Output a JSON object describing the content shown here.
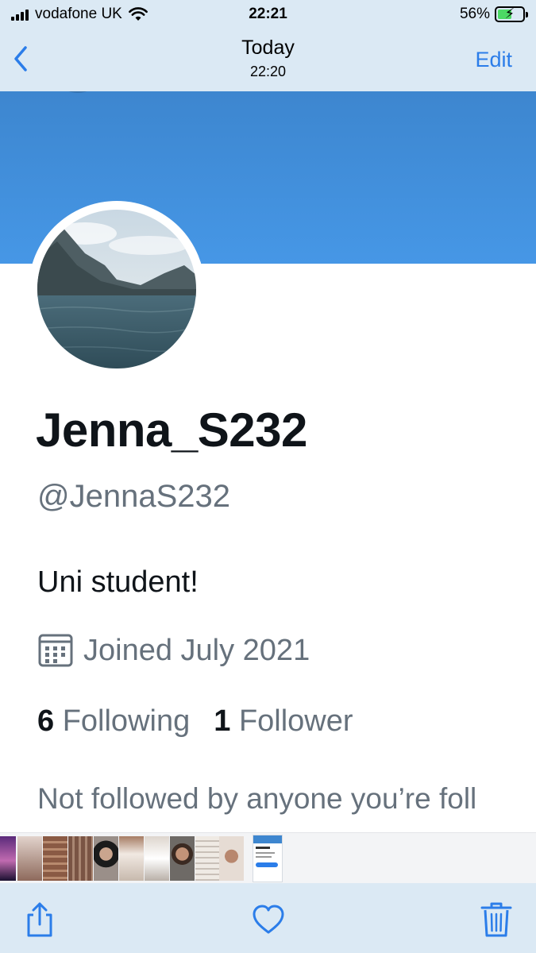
{
  "status_bar": {
    "carrier": "vodafone UK",
    "time": "22:21",
    "battery_percent": "56%",
    "battery_level": 0.56,
    "signal_icon": "cellular-signal-icon",
    "wifi_icon": "wifi-icon",
    "battery_icon": "battery-charging-icon"
  },
  "nav": {
    "title": "Today",
    "subtitle": "22:20",
    "edit_label": "Edit",
    "back_icon": "chevron-left-icon"
  },
  "profile": {
    "display_name": "Jenna_S232",
    "handle": "@JennaS232",
    "bio": "Uni student!",
    "joined": "Joined July 2021",
    "following_count": "6",
    "following_label": "Following",
    "followers_count": "1",
    "followers_label": "Follower",
    "not_followed": "Not followed by anyone you’re foll",
    "calendar_icon": "calendar-icon",
    "avatar_description_icon": "mountain-lake-avatar"
  },
  "toolbar": {
    "share_icon": "share-icon",
    "favorite_icon": "heart-icon",
    "delete_icon": "trash-icon"
  },
  "colors": {
    "ios_tint": "#2b7de9",
    "chrome_bg": "#dbe9f4",
    "banner_blue": "#4697e6",
    "twitter_text": "#0f1419",
    "twitter_secondary": "#66717c"
  }
}
